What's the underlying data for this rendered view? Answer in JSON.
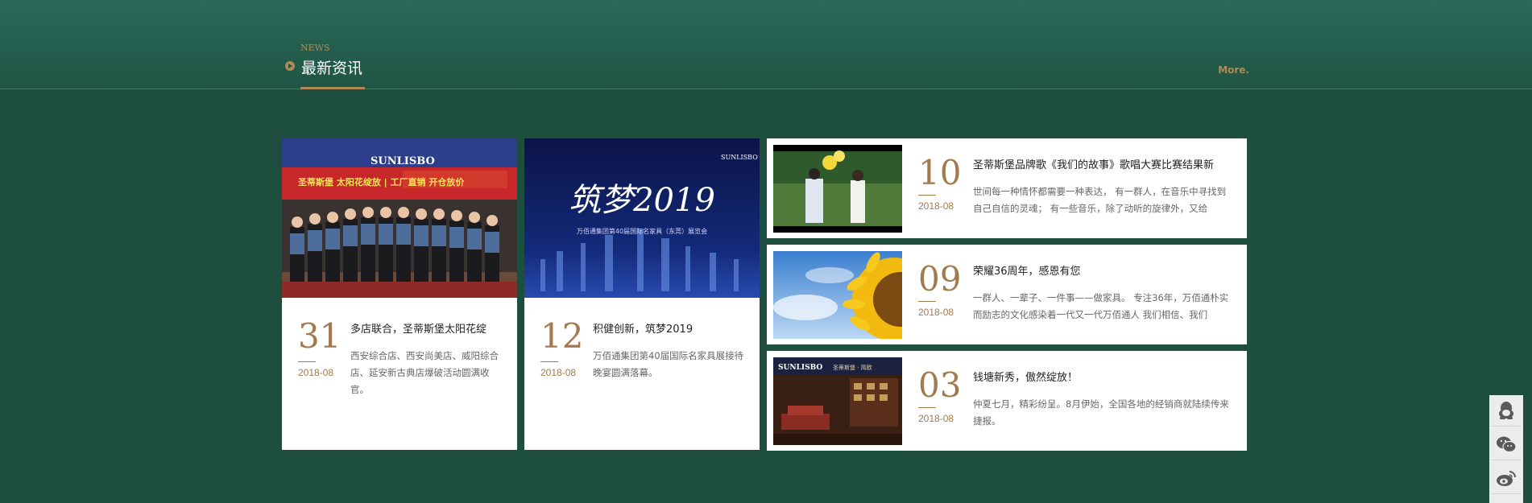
{
  "section": {
    "en_label": "NEWS",
    "title": "最新资讯",
    "more_label": "More."
  },
  "cards": [
    {
      "day": "31",
      "month": "2018-08",
      "title": "多店联合，圣蒂斯堡太阳花绽",
      "desc": "西安综合店、西安尚美店、威阳综合店、延安新古典店爆破活动圆满收官。",
      "image": {
        "banner_brand": "SUNLISBO",
        "banner_text": "圣蒂斯堡 太阳花绽放 | 工厂直销 开仓放价"
      }
    },
    {
      "day": "12",
      "month": "2018-08",
      "title": "积健创新，筑梦2019",
      "desc": "万佰通集团第40届国际名家具展接待晚宴圆满落幕。",
      "image": {
        "brand": "SUNLISBO",
        "headline": "筑梦2019",
        "subline": "万佰通集团第40届国际名家具（东莞）展览会"
      }
    }
  ],
  "list": [
    {
      "day": "10",
      "month": "2018-08",
      "title": "圣蒂斯堡品牌歌《我们的故事》歌唱大赛比赛结果新",
      "desc": "世间每一种情怀都需要一种表达， 有一群人，在音乐中寻找到自己自信的灵魂； 有一些音乐，除了动听的旋律外，又给"
    },
    {
      "day": "09",
      "month": "2018-08",
      "title": "荣耀36周年，感恩有您",
      "desc": "一群人、一辈子、一件事——做家具。 专注36年，万佰通朴实而励志的文化感染着一代又一代万佰通人 我们相信、我们"
    },
    {
      "day": "03",
      "month": "2018-08",
      "title": "钱塘新秀，傲然绽放！",
      "desc": "仲夏七月，精彩纷呈。8月伊始，全国各地的经销商就陆续传来捷报。",
      "image": {
        "brand": "SUNLISBO",
        "sign": "圣蒂斯堡 · 简欧"
      }
    }
  ],
  "side_tools": [
    "qq-icon",
    "wechat-icon",
    "weibo-icon"
  ]
}
